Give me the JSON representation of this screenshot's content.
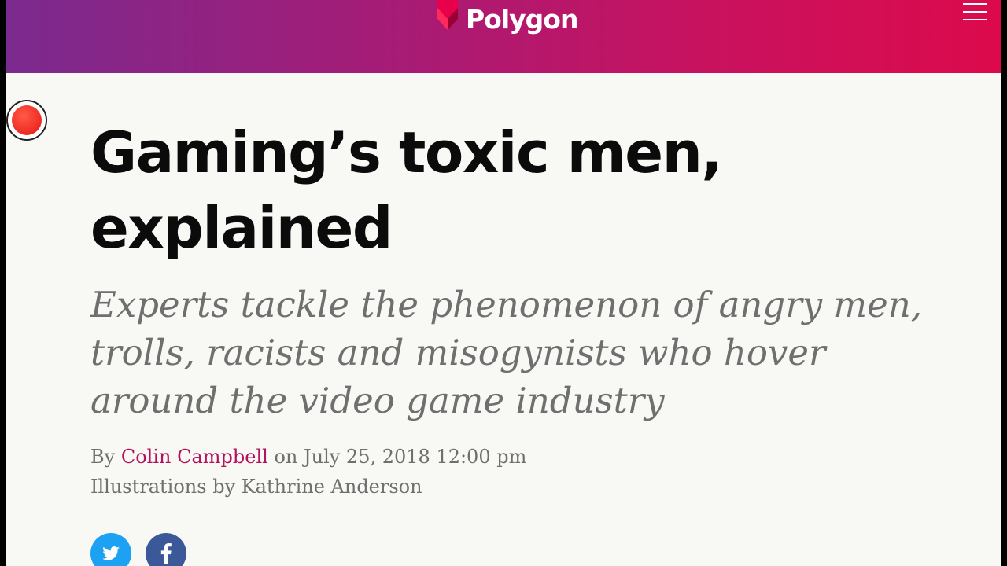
{
  "header": {
    "brand_name": "Polygon",
    "gradient_start": "#7b2a8f",
    "gradient_end": "#dc0a4c",
    "menu_icon": "hamburger-menu-icon"
  },
  "article": {
    "headline_line1": "Gaming’s toxic men,",
    "headline_line2": "explained",
    "dek_line1": "Experts tackle the phenomenon of angry men,",
    "dek_line2": "trolls, racists and misogynists who hover",
    "dek_line3": "around the video game industry",
    "byline_prefix": "By",
    "author": "Colin Campbell",
    "date_text": "on July 25, 2018 12:00 pm",
    "illustrations_credit": "Illustrations by Kathrine Anderson",
    "author_link_color": "#b3125e"
  },
  "share": {
    "twitter_icon": "twitter-icon",
    "facebook_icon": "facebook-icon",
    "twitter_color": "#1da1f2",
    "facebook_color": "#3b5998"
  },
  "overlay": {
    "record_icon": "screen-record-indicator-icon",
    "record_color": "#ee2a20"
  }
}
